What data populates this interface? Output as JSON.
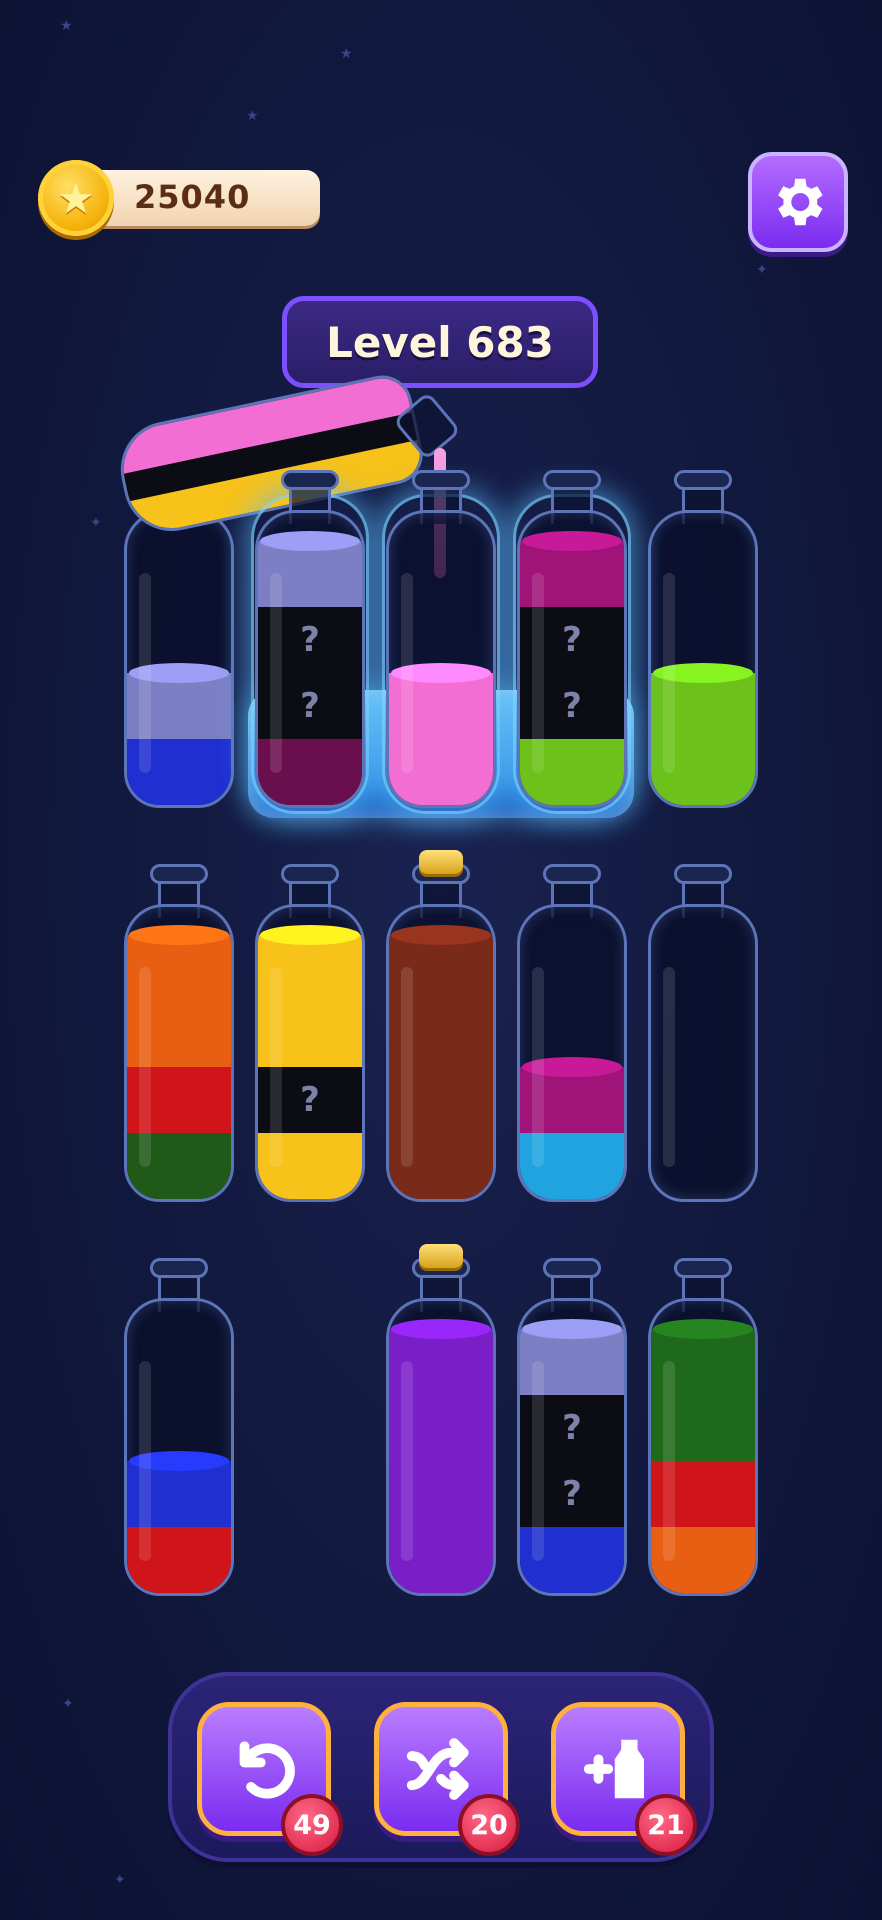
{
  "coins": {
    "value": "25040",
    "icon": "star-coin-icon"
  },
  "settings": {
    "icon": "gear-icon"
  },
  "level": {
    "label": "Level 683"
  },
  "colors": {
    "pink": "#f36ed2",
    "lavender": "#7d7fc4",
    "blue": "#1f2fd0",
    "dark_purple": "#6a0f4e",
    "magenta": "#a0147a",
    "lime": "#6cc21a",
    "orange": "#e85e12",
    "red": "#d0151a",
    "dark_green": "#1f5a18",
    "yellow": "#f7c21a",
    "brown": "#7a2a18",
    "cyan": "#1fa4e0",
    "violet": "#7a1fc8",
    "green": "#1f6a1a",
    "mystery": "#0c0c14"
  },
  "bottles_row1": [
    {
      "name": "bottle-r1-1",
      "segments": [
        "blue",
        "lavender"
      ]
    },
    {
      "name": "bottle-r1-2",
      "frozen": true,
      "segments": [
        "dark_purple",
        "mystery",
        "mystery",
        "lavender"
      ],
      "mystery_mark": "?"
    },
    {
      "name": "bottle-r1-3",
      "frozen": true,
      "segments": [
        "pink",
        "pink"
      ]
    },
    {
      "name": "bottle-r1-4",
      "frozen": true,
      "segments": [
        "lime",
        "mystery",
        "mystery",
        "magenta"
      ],
      "mystery_mark": "?"
    },
    {
      "name": "bottle-r1-5",
      "segments": [
        "lime",
        "lime"
      ]
    }
  ],
  "bottles_row2": [
    {
      "name": "bottle-r2-1",
      "segments": [
        "dark_green",
        "red",
        "orange",
        "orange"
      ]
    },
    {
      "name": "bottle-r2-2",
      "segments": [
        "yellow",
        "mystery",
        "yellow",
        "yellow"
      ],
      "mystery_mark": "?"
    },
    {
      "name": "bottle-r2-3",
      "corked": true,
      "segments": [
        "brown",
        "brown",
        "brown",
        "brown"
      ]
    },
    {
      "name": "bottle-r2-4",
      "segments": [
        "cyan",
        "magenta"
      ]
    },
    {
      "name": "bottle-r2-5",
      "segments": []
    }
  ],
  "bottles_row3": [
    {
      "name": "bottle-r3-1",
      "segments": [
        "red",
        "blue"
      ]
    },
    {
      "name": "bottle-r3-2",
      "corked": true,
      "segments": [
        "violet",
        "violet",
        "violet",
        "violet"
      ]
    },
    {
      "name": "bottle-r3-3",
      "segments": [
        "blue",
        "mystery",
        "mystery",
        "lavender"
      ],
      "mystery_mark": "?"
    },
    {
      "name": "bottle-r3-4",
      "segments": [
        "orange",
        "red",
        "green",
        "green"
      ]
    }
  ],
  "pouring_bottle": {
    "segments": [
      "yellow",
      "mystery",
      "pink"
    ]
  },
  "toolbar": {
    "undo": {
      "icon": "undo-icon",
      "count": "49"
    },
    "shuffle": {
      "icon": "shuffle-icon",
      "count": "20"
    },
    "add_bottle": {
      "icon": "add-bottle-icon",
      "count": "21"
    }
  }
}
